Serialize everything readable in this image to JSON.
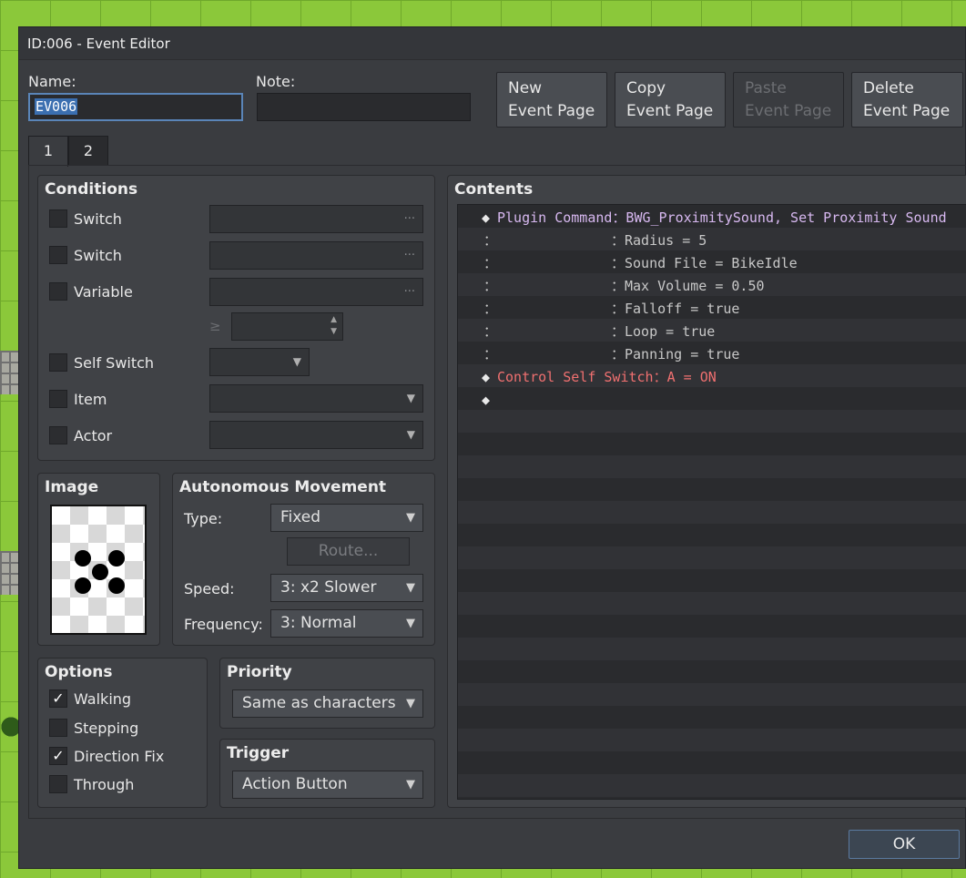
{
  "window": {
    "title": "ID:006 - Event Editor"
  },
  "header": {
    "name_label": "Name:",
    "name_value": "EV006",
    "note_label": "Note:",
    "note_value": "",
    "buttons": {
      "new": [
        "New",
        "Event Page"
      ],
      "copy": [
        "Copy",
        "Event Page"
      ],
      "paste": [
        "Paste",
        "Event Page"
      ],
      "delete": [
        "Delete",
        "Event Page"
      ]
    }
  },
  "tabs": [
    {
      "label": "1",
      "active": true
    },
    {
      "label": "2",
      "active": false
    }
  ],
  "conditions": {
    "title": "Conditions",
    "switch1": {
      "label": "Switch",
      "checked": false
    },
    "switch2": {
      "label": "Switch",
      "checked": false
    },
    "variable": {
      "label": "Variable",
      "checked": false
    },
    "compare_symbol": "≥",
    "self_switch": {
      "label": "Self Switch",
      "checked": false
    },
    "item": {
      "label": "Item",
      "checked": false
    },
    "actor": {
      "label": "Actor",
      "checked": false
    },
    "dots": "···"
  },
  "image": {
    "title": "Image"
  },
  "movement": {
    "title": "Autonomous Movement",
    "type_label": "Type:",
    "type_value": "Fixed",
    "route_label": "Route...",
    "speed_label": "Speed:",
    "speed_value": "3: x2 Slower",
    "frequency_label": "Frequency:",
    "frequency_value": "3: Normal"
  },
  "options": {
    "title": "Options",
    "walking": {
      "label": "Walking",
      "checked": true
    },
    "stepping": {
      "label": "Stepping",
      "checked": false
    },
    "direction_fix": {
      "label": "Direction Fix",
      "checked": true
    },
    "through": {
      "label": "Through",
      "checked": false
    }
  },
  "priority": {
    "title": "Priority",
    "value": "Same as characters"
  },
  "trigger": {
    "title": "Trigger",
    "value": "Action Button"
  },
  "contents": {
    "title": "Contents",
    "lines": [
      {
        "prefix": "◆",
        "head": "Plugin Command",
        "sep": "：",
        "text": "BWG_ProximitySound, Set Proximity Sound",
        "color": "purple"
      },
      {
        "prefix": "：",
        "head": "",
        "sep": "：",
        "text": "Radius = 5",
        "color": "gray"
      },
      {
        "prefix": "：",
        "head": "",
        "sep": "：",
        "text": "Sound File = BikeIdle",
        "color": "gray"
      },
      {
        "prefix": "：",
        "head": "",
        "sep": "：",
        "text": "Max Volume = 0.50",
        "color": "gray"
      },
      {
        "prefix": "：",
        "head": "",
        "sep": "：",
        "text": "Falloff = true",
        "color": "gray"
      },
      {
        "prefix": "：",
        "head": "",
        "sep": "：",
        "text": "Loop = true",
        "color": "gray"
      },
      {
        "prefix": "：",
        "head": "",
        "sep": "：",
        "text": "Panning = true",
        "color": "gray"
      },
      {
        "prefix": "◆",
        "head": "Control Self Switch",
        "sep": "：",
        "text": "A = ON",
        "color": "red"
      },
      {
        "prefix": "◆",
        "head": "",
        "sep": "",
        "text": "",
        "color": "gray"
      }
    ]
  },
  "footer": {
    "ok_label": "OK"
  },
  "icons": {
    "check": "✓",
    "combo_arrow": "▼",
    "spin_up": "▲",
    "spin_down": "▼"
  }
}
